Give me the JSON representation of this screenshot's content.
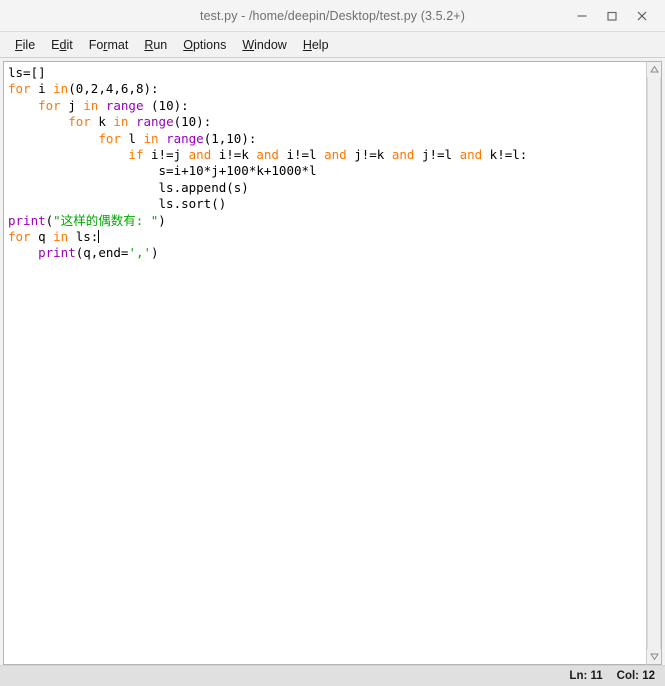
{
  "window": {
    "title": "test.py - /home/deepin/Desktop/test.py (3.5.2+)",
    "controls": {
      "minimize": "minimize",
      "maximize": "maximize",
      "close": "close"
    }
  },
  "menubar": {
    "items": [
      {
        "label": "File",
        "mnemonic_index": 0
      },
      {
        "label": "Edit",
        "mnemonic_index": 1
      },
      {
        "label": "Format",
        "mnemonic_index": 2
      },
      {
        "label": "Run",
        "mnemonic_index": 0
      },
      {
        "label": "Options",
        "mnemonic_index": 0
      },
      {
        "label": "Window",
        "mnemonic_index": 0
      },
      {
        "label": "Help",
        "mnemonic_index": 0
      }
    ]
  },
  "editor": {
    "lines": [
      [
        {
          "t": "ls=[]",
          "c": "plain"
        }
      ],
      [
        {
          "t": "for",
          "c": "kw"
        },
        {
          "t": " i ",
          "c": "plain"
        },
        {
          "t": "in",
          "c": "kw"
        },
        {
          "t": "(0,2,4,6,8):",
          "c": "plain"
        }
      ],
      [
        {
          "t": "    ",
          "c": "plain"
        },
        {
          "t": "for",
          "c": "kw"
        },
        {
          "t": " j ",
          "c": "plain"
        },
        {
          "t": "in",
          "c": "kw"
        },
        {
          "t": " ",
          "c": "plain"
        },
        {
          "t": "range",
          "c": "builtin"
        },
        {
          "t": " (10):",
          "c": "plain"
        }
      ],
      [
        {
          "t": "        ",
          "c": "plain"
        },
        {
          "t": "for",
          "c": "kw"
        },
        {
          "t": " k ",
          "c": "plain"
        },
        {
          "t": "in",
          "c": "kw"
        },
        {
          "t": " ",
          "c": "plain"
        },
        {
          "t": "range",
          "c": "builtin"
        },
        {
          "t": "(10):",
          "c": "plain"
        }
      ],
      [
        {
          "t": "            ",
          "c": "plain"
        },
        {
          "t": "for",
          "c": "kw"
        },
        {
          "t": " l ",
          "c": "plain"
        },
        {
          "t": "in",
          "c": "kw"
        },
        {
          "t": " ",
          "c": "plain"
        },
        {
          "t": "range",
          "c": "builtin"
        },
        {
          "t": "(1,10):",
          "c": "plain"
        }
      ],
      [
        {
          "t": "                ",
          "c": "plain"
        },
        {
          "t": "if",
          "c": "kw"
        },
        {
          "t": " i!=j ",
          "c": "plain"
        },
        {
          "t": "and",
          "c": "kw"
        },
        {
          "t": " i!=k ",
          "c": "plain"
        },
        {
          "t": "and",
          "c": "kw"
        },
        {
          "t": " i!=l ",
          "c": "plain"
        },
        {
          "t": "and",
          "c": "kw"
        },
        {
          "t": " j!=k ",
          "c": "plain"
        },
        {
          "t": "and",
          "c": "kw"
        },
        {
          "t": " j!=l ",
          "c": "plain"
        },
        {
          "t": "and",
          "c": "kw"
        },
        {
          "t": " k!=l:",
          "c": "plain"
        }
      ],
      [
        {
          "t": "                    s=i+10*j+100*k+1000*l",
          "c": "plain"
        }
      ],
      [
        {
          "t": "                    ls.append(s)",
          "c": "plain"
        }
      ],
      [
        {
          "t": "                    ls.sort()",
          "c": "plain"
        }
      ],
      [
        {
          "t": "print",
          "c": "builtin"
        },
        {
          "t": "(",
          "c": "plain"
        },
        {
          "t": "\"这样的偶数有: \"",
          "c": "str"
        },
        {
          "t": ")",
          "c": "plain"
        }
      ],
      [
        {
          "t": "for",
          "c": "kw"
        },
        {
          "t": " q ",
          "c": "plain"
        },
        {
          "t": "in",
          "c": "kw"
        },
        {
          "t": " ls:",
          "c": "plain"
        },
        {
          "t": "",
          "c": "caret"
        }
      ],
      [
        {
          "t": "    ",
          "c": "plain"
        },
        {
          "t": "print",
          "c": "builtin"
        },
        {
          "t": "(q,end=",
          "c": "plain"
        },
        {
          "t": "','",
          "c": "str"
        },
        {
          "t": ")",
          "c": "plain"
        }
      ]
    ],
    "scrollbar": {
      "up_arrow": "scroll-up",
      "down_arrow": "scroll-down"
    }
  },
  "statusbar": {
    "line_label": "Ln: 11",
    "col_label": "Col: 12"
  },
  "colors": {
    "keyword": "#ff7700",
    "builtin": "#9900bb",
    "string": "#00aa00",
    "text": "#000000",
    "editor_bg": "#ffffff",
    "chrome_bg": "#f2f2f2",
    "statusbar_bg": "#e0e0e0"
  }
}
